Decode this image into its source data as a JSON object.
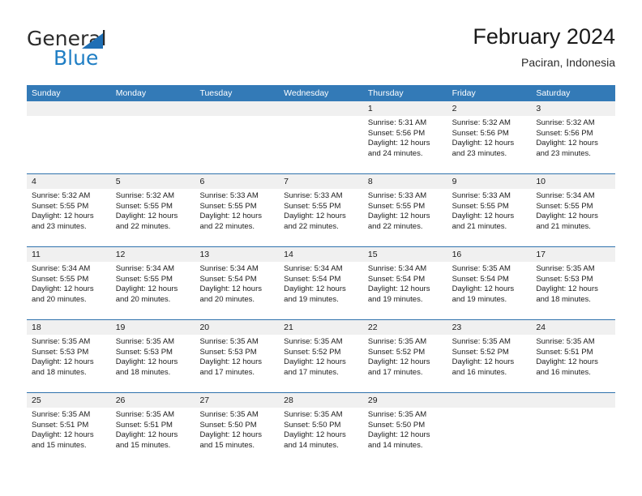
{
  "logo": {
    "word_top": "General",
    "word_bottom": "Blue",
    "triangle_color": "#1f6fb5",
    "blue_color": "#1f7ec4"
  },
  "header": {
    "title": "February 2024",
    "location": "Paciran, Indonesia"
  },
  "theme": {
    "header_row_bg": "#337ab7",
    "row_divider": "#2f72ad",
    "day_number_strip_bg": "#f0f0f0"
  },
  "weekdays": [
    "Sunday",
    "Monday",
    "Tuesday",
    "Wednesday",
    "Thursday",
    "Friday",
    "Saturday"
  ],
  "weeks": [
    [
      {
        "day": "",
        "lines": []
      },
      {
        "day": "",
        "lines": []
      },
      {
        "day": "",
        "lines": []
      },
      {
        "day": "",
        "lines": []
      },
      {
        "day": "1",
        "lines": [
          "Sunrise: 5:31 AM",
          "Sunset: 5:56 PM",
          "Daylight: 12 hours",
          "and 24 minutes."
        ]
      },
      {
        "day": "2",
        "lines": [
          "Sunrise: 5:32 AM",
          "Sunset: 5:56 PM",
          "Daylight: 12 hours",
          "and 23 minutes."
        ]
      },
      {
        "day": "3",
        "lines": [
          "Sunrise: 5:32 AM",
          "Sunset: 5:56 PM",
          "Daylight: 12 hours",
          "and 23 minutes."
        ]
      }
    ],
    [
      {
        "day": "4",
        "lines": [
          "Sunrise: 5:32 AM",
          "Sunset: 5:55 PM",
          "Daylight: 12 hours",
          "and 23 minutes."
        ]
      },
      {
        "day": "5",
        "lines": [
          "Sunrise: 5:32 AM",
          "Sunset: 5:55 PM",
          "Daylight: 12 hours",
          "and 22 minutes."
        ]
      },
      {
        "day": "6",
        "lines": [
          "Sunrise: 5:33 AM",
          "Sunset: 5:55 PM",
          "Daylight: 12 hours",
          "and 22 minutes."
        ]
      },
      {
        "day": "7",
        "lines": [
          "Sunrise: 5:33 AM",
          "Sunset: 5:55 PM",
          "Daylight: 12 hours",
          "and 22 minutes."
        ]
      },
      {
        "day": "8",
        "lines": [
          "Sunrise: 5:33 AM",
          "Sunset: 5:55 PM",
          "Daylight: 12 hours",
          "and 22 minutes."
        ]
      },
      {
        "day": "9",
        "lines": [
          "Sunrise: 5:33 AM",
          "Sunset: 5:55 PM",
          "Daylight: 12 hours",
          "and 21 minutes."
        ]
      },
      {
        "day": "10",
        "lines": [
          "Sunrise: 5:34 AM",
          "Sunset: 5:55 PM",
          "Daylight: 12 hours",
          "and 21 minutes."
        ]
      }
    ],
    [
      {
        "day": "11",
        "lines": [
          "Sunrise: 5:34 AM",
          "Sunset: 5:55 PM",
          "Daylight: 12 hours",
          "and 20 minutes."
        ]
      },
      {
        "day": "12",
        "lines": [
          "Sunrise: 5:34 AM",
          "Sunset: 5:55 PM",
          "Daylight: 12 hours",
          "and 20 minutes."
        ]
      },
      {
        "day": "13",
        "lines": [
          "Sunrise: 5:34 AM",
          "Sunset: 5:54 PM",
          "Daylight: 12 hours",
          "and 20 minutes."
        ]
      },
      {
        "day": "14",
        "lines": [
          "Sunrise: 5:34 AM",
          "Sunset: 5:54 PM",
          "Daylight: 12 hours",
          "and 19 minutes."
        ]
      },
      {
        "day": "15",
        "lines": [
          "Sunrise: 5:34 AM",
          "Sunset: 5:54 PM",
          "Daylight: 12 hours",
          "and 19 minutes."
        ]
      },
      {
        "day": "16",
        "lines": [
          "Sunrise: 5:35 AM",
          "Sunset: 5:54 PM",
          "Daylight: 12 hours",
          "and 19 minutes."
        ]
      },
      {
        "day": "17",
        "lines": [
          "Sunrise: 5:35 AM",
          "Sunset: 5:53 PM",
          "Daylight: 12 hours",
          "and 18 minutes."
        ]
      }
    ],
    [
      {
        "day": "18",
        "lines": [
          "Sunrise: 5:35 AM",
          "Sunset: 5:53 PM",
          "Daylight: 12 hours",
          "and 18 minutes."
        ]
      },
      {
        "day": "19",
        "lines": [
          "Sunrise: 5:35 AM",
          "Sunset: 5:53 PM",
          "Daylight: 12 hours",
          "and 18 minutes."
        ]
      },
      {
        "day": "20",
        "lines": [
          "Sunrise: 5:35 AM",
          "Sunset: 5:53 PM",
          "Daylight: 12 hours",
          "and 17 minutes."
        ]
      },
      {
        "day": "21",
        "lines": [
          "Sunrise: 5:35 AM",
          "Sunset: 5:52 PM",
          "Daylight: 12 hours",
          "and 17 minutes."
        ]
      },
      {
        "day": "22",
        "lines": [
          "Sunrise: 5:35 AM",
          "Sunset: 5:52 PM",
          "Daylight: 12 hours",
          "and 17 minutes."
        ]
      },
      {
        "day": "23",
        "lines": [
          "Sunrise: 5:35 AM",
          "Sunset: 5:52 PM",
          "Daylight: 12 hours",
          "and 16 minutes."
        ]
      },
      {
        "day": "24",
        "lines": [
          "Sunrise: 5:35 AM",
          "Sunset: 5:51 PM",
          "Daylight: 12 hours",
          "and 16 minutes."
        ]
      }
    ],
    [
      {
        "day": "25",
        "lines": [
          "Sunrise: 5:35 AM",
          "Sunset: 5:51 PM",
          "Daylight: 12 hours",
          "and 15 minutes."
        ]
      },
      {
        "day": "26",
        "lines": [
          "Sunrise: 5:35 AM",
          "Sunset: 5:51 PM",
          "Daylight: 12 hours",
          "and 15 minutes."
        ]
      },
      {
        "day": "27",
        "lines": [
          "Sunrise: 5:35 AM",
          "Sunset: 5:50 PM",
          "Daylight: 12 hours",
          "and 15 minutes."
        ]
      },
      {
        "day": "28",
        "lines": [
          "Sunrise: 5:35 AM",
          "Sunset: 5:50 PM",
          "Daylight: 12 hours",
          "and 14 minutes."
        ]
      },
      {
        "day": "29",
        "lines": [
          "Sunrise: 5:35 AM",
          "Sunset: 5:50 PM",
          "Daylight: 12 hours",
          "and 14 minutes."
        ]
      },
      {
        "day": "",
        "lines": []
      },
      {
        "day": "",
        "lines": []
      }
    ]
  ]
}
